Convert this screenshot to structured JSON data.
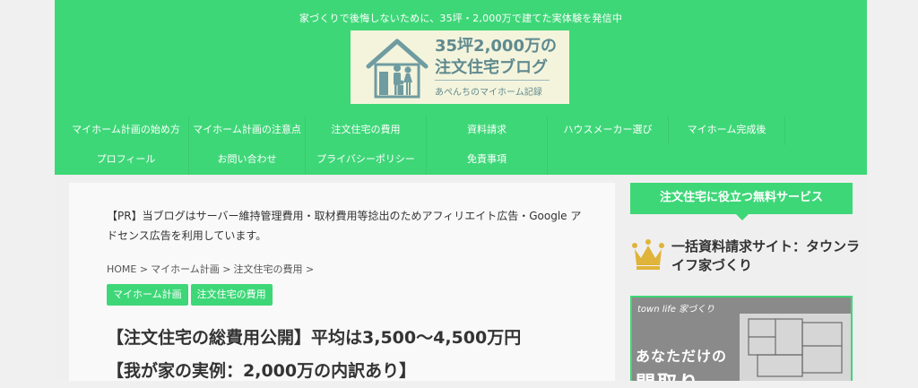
{
  "header": {
    "tagline": "家づくりで後悔しないために、35坪・2,000万で建てた実体験を発信中",
    "logo_title_line1": "35坪2,000万の",
    "logo_title_line2": "注文住宅ブログ",
    "logo_subtitle": "あぺんちのマイホーム記録"
  },
  "nav": {
    "items": [
      "マイホーム計画の始め方",
      "マイホーム計画の注意点",
      "注文住宅の費用",
      "資料請求",
      "ハウスメーカー選び",
      "マイホーム完成後",
      "プロフィール",
      "お問い合わせ",
      "プライバシーポリシー",
      "免責事項"
    ]
  },
  "content": {
    "pr_text": "【PR】当ブログはサーバー維持管理費用・取材費用等捻出のためアフィリエイト広告・Google アドセンス広告を利用しています。",
    "breadcrumb": [
      "HOME >",
      "マイホーム計画 >",
      "注文住宅の費用 >"
    ],
    "tags": [
      "マイホーム計画",
      "注文住宅の費用"
    ],
    "title_line1": "【注文住宅の総費用公開】平均は3,500〜4,500万円",
    "title_line2": "【我が家の実例：2,000万の内訳あり】"
  },
  "sidebar": {
    "heading": "注文住宅に役立つ無料サービス",
    "item_title": "一括資料請求サイト：タウンライフ家づくり",
    "banner_brand": "town life 家づくり",
    "banner_text": "あなただけの",
    "banner_text2": "間取り"
  },
  "colors": {
    "accent": "#3ed778",
    "logo_bg": "#f4f4dc",
    "logo_text": "#5f8a8f",
    "crown": "#e0b33a"
  }
}
